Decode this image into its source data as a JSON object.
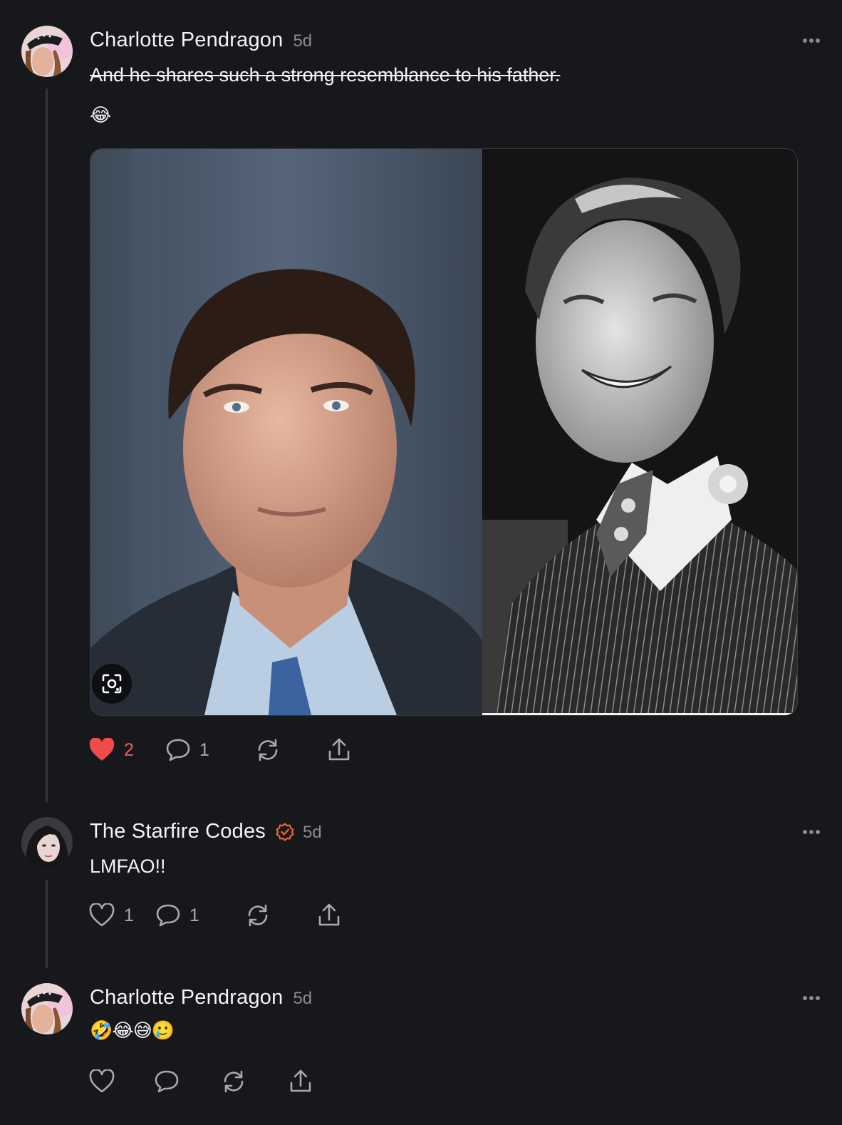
{
  "posts": [
    {
      "author": "Charlotte Pendragon",
      "time": "5d",
      "text": "And he shares such a strong resemblance to his father.",
      "emoji": "😂",
      "media": {
        "left_alt": "Portrait of man in blue suit",
        "right_alt": "Black and white photo of smiling man in pinstripe suit with rose"
      },
      "actions": {
        "likes": "2",
        "comments": "1"
      },
      "liked": true
    },
    {
      "author": "The Starfire Codes",
      "time": "5d",
      "text": "LMFAO!!",
      "verified": true,
      "actions": {
        "likes": "1",
        "comments": "1"
      },
      "liked": false
    },
    {
      "author": "Charlotte Pendragon",
      "time": "5d",
      "emoji": "🤣😂😅🥲",
      "actions": {
        "likes": "",
        "comments": ""
      },
      "liked": false
    }
  ],
  "icons": [
    "more-icon",
    "heart-icon",
    "comment-icon",
    "repost-icon",
    "share-icon",
    "lens-icon",
    "verified-icon"
  ],
  "colors": {
    "background": "#17181c",
    "like": "#ef5a5a",
    "verified": "#f0642d",
    "muted": "#8a8b90"
  }
}
